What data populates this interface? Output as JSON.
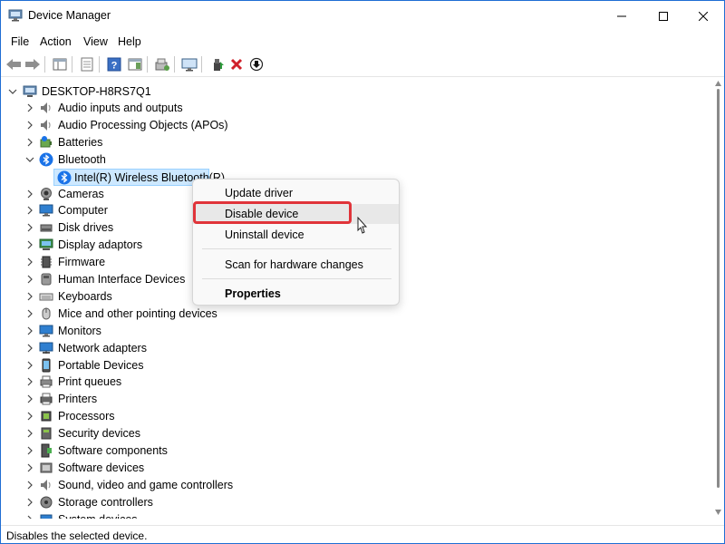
{
  "window": {
    "title": "Device Manager"
  },
  "menu": {
    "items": [
      {
        "label": "File"
      },
      {
        "label": "Action"
      },
      {
        "label": "View"
      },
      {
        "label": "Help"
      }
    ]
  },
  "toolbar": {
    "buttons": [
      {
        "icon": "back-arrow-icon"
      },
      {
        "icon": "forward-arrow-icon"
      },
      {
        "icon": "show-hide-console-tree-icon"
      },
      {
        "icon": "properties-icon"
      },
      {
        "icon": "help-icon"
      },
      {
        "icon": "action-pane-icon"
      },
      {
        "icon": "scan-hardware-icon"
      },
      {
        "icon": "monitor-icon"
      },
      {
        "icon": "update-driver-icon"
      },
      {
        "icon": "uninstall-x-icon"
      },
      {
        "icon": "disable-device-icon"
      }
    ]
  },
  "tree": {
    "root": "DESKTOP-H8RS7Q1",
    "categories": [
      {
        "label": "Audio inputs and outputs",
        "icon": "speaker-icon",
        "expanded": false
      },
      {
        "label": "Audio Processing Objects (APOs)",
        "icon": "speaker-icon",
        "expanded": false
      },
      {
        "label": "Batteries",
        "icon": "battery-icon",
        "expanded": false
      },
      {
        "label": "Bluetooth",
        "icon": "bluetooth-icon",
        "expanded": true,
        "children": [
          "Intel(R) Wireless Bluetooth(R)"
        ]
      },
      {
        "label": "Cameras",
        "icon": "camera-icon",
        "expanded": false
      },
      {
        "label": "Computer",
        "icon": "computer-icon",
        "expanded": false
      },
      {
        "label": "Disk drives",
        "icon": "disk-drive-icon",
        "expanded": false
      },
      {
        "label": "Display adaptors",
        "icon": "display-adapter-icon",
        "expanded": false
      },
      {
        "label": "Firmware",
        "icon": "firmware-icon",
        "expanded": false
      },
      {
        "label": "Human Interface Devices",
        "icon": "hid-icon",
        "expanded": false
      },
      {
        "label": "Keyboards",
        "icon": "keyboard-icon",
        "expanded": false
      },
      {
        "label": "Mice and other pointing devices",
        "icon": "mouse-icon",
        "expanded": false
      },
      {
        "label": "Monitors",
        "icon": "monitor-icon",
        "expanded": false
      },
      {
        "label": "Network adapters",
        "icon": "network-adapter-icon",
        "expanded": false
      },
      {
        "label": "Portable Devices",
        "icon": "portable-device-icon",
        "expanded": false
      },
      {
        "label": "Print queues",
        "icon": "print-queue-icon",
        "expanded": false
      },
      {
        "label": "Printers",
        "icon": "printer-icon",
        "expanded": false
      },
      {
        "label": "Processors",
        "icon": "processor-icon",
        "expanded": false
      },
      {
        "label": "Security devices",
        "icon": "security-device-icon",
        "expanded": false
      },
      {
        "label": "Software components",
        "icon": "software-component-icon",
        "expanded": false
      },
      {
        "label": "Software devices",
        "icon": "software-device-icon",
        "expanded": false
      },
      {
        "label": "Sound, video and game controllers",
        "icon": "sound-controller-icon",
        "expanded": false
      },
      {
        "label": "Storage controllers",
        "icon": "storage-controller-icon",
        "expanded": false
      },
      {
        "label": "System devices",
        "icon": "system-device-icon",
        "expanded": false
      }
    ]
  },
  "context_menu": {
    "items": [
      {
        "label": "Update driver"
      },
      {
        "label": "Disable device",
        "highlighted": true
      },
      {
        "label": "Uninstall device"
      },
      {
        "label": "Scan for hardware changes"
      },
      {
        "label": "Properties",
        "bold": true
      }
    ]
  },
  "status": {
    "text": "Disables the selected device."
  },
  "colors": {
    "accent": "#1f6ed4",
    "selection": "#cde8ff",
    "highlight_box": "#e0343a"
  }
}
